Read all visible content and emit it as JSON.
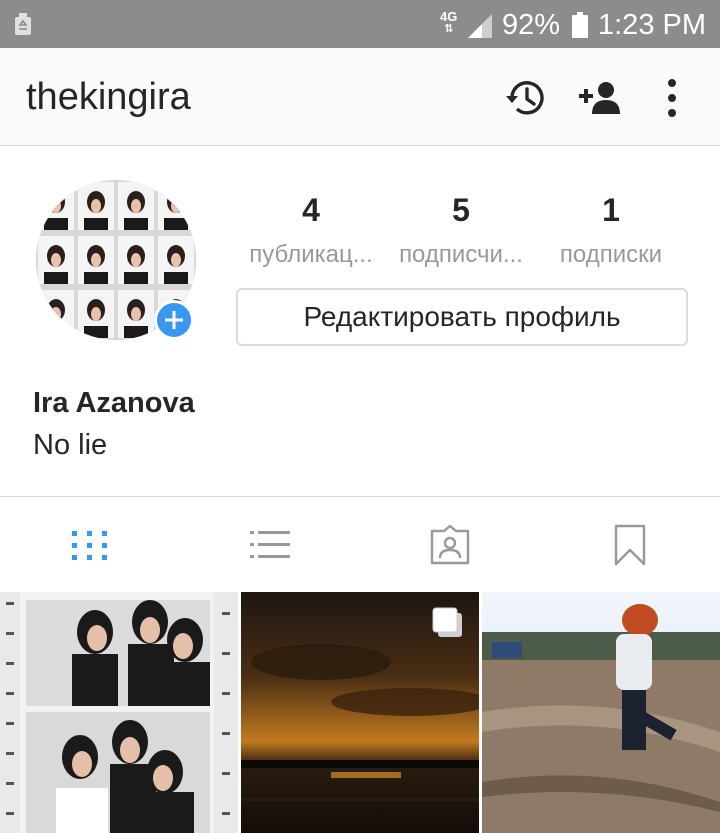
{
  "status_bar": {
    "network": "4G",
    "battery_percent": "92%",
    "time": "1:23 PM",
    "icons": [
      "recycle-icon",
      "signal-icon",
      "battery-icon"
    ]
  },
  "app_bar": {
    "username": "thekingira",
    "icons": [
      "history-icon",
      "add-user-icon",
      "more-vertical-icon"
    ]
  },
  "profile": {
    "stats": [
      {
        "value": "4",
        "label": "публикац..."
      },
      {
        "value": "5",
        "label": "подписчи..."
      },
      {
        "value": "1",
        "label": "подписки"
      }
    ],
    "edit_button_label": "Редактировать профиль",
    "full_name": "Ira Azanova",
    "bio": "No lie"
  },
  "tabs": {
    "items": [
      "grid-icon",
      "list-icon",
      "tagged-icon",
      "bookmark-icon"
    ],
    "active": "grid-icon"
  },
  "colors": {
    "status_bar": "#8c8c8c",
    "accent": "#3897f0",
    "text": "#262626",
    "muted": "#999999",
    "border": "#dbdbdb"
  },
  "photos": {
    "items": [
      "photo-girls-film-strip",
      "photo-sunset-lake",
      "photo-girl-jumping"
    ],
    "multi_indicator_on": "photo-sunset-lake"
  }
}
